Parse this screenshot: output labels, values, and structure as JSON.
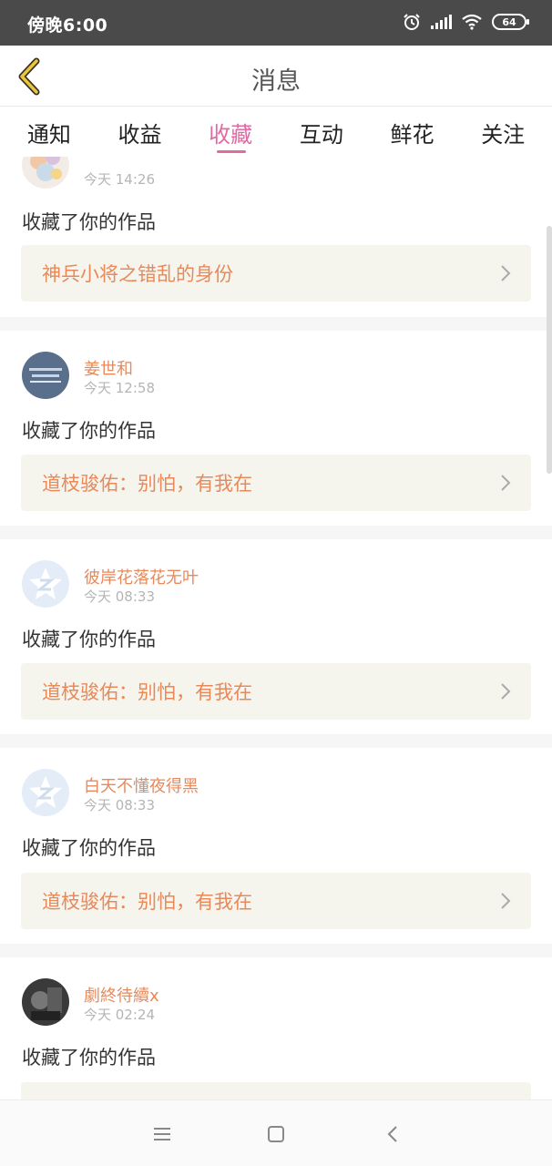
{
  "status_bar": {
    "time": "傍晚6:00",
    "battery": "64"
  },
  "header": {
    "title": "消息"
  },
  "tabs": [
    {
      "label": "通知",
      "active": false
    },
    {
      "label": "收益",
      "active": false
    },
    {
      "label": "收藏",
      "active": true
    },
    {
      "label": "互动",
      "active": false
    },
    {
      "label": "鲜花",
      "active": false
    },
    {
      "label": "关注",
      "active": false
    }
  ],
  "colors": {
    "accent": "#e06aa2",
    "name": "#e8895a",
    "work_bg": "#f5f5ee"
  },
  "messages": [
    {
      "username": "",
      "time": "今天 14:26",
      "action": "收藏了你的作品",
      "work": "神兵小将之错乱的身份"
    },
    {
      "username": "姜世和",
      "time": "今天 12:58",
      "action": "收藏了你的作品",
      "work": "道枝骏佑：别怕，有我在"
    },
    {
      "username": "彼岸花落花无叶",
      "time": "今天 08:33",
      "action": "收藏了你的作品",
      "work": "道枝骏佑：别怕，有我在"
    },
    {
      "username": "白天不懂夜得黑",
      "time": "今天 08:33",
      "action": "收藏了你的作品",
      "work": "道枝骏佑：别怕，有我在"
    },
    {
      "username": "劇終待續x",
      "time": "今天 02:24",
      "action": "收藏了你的作品",
      "work": ""
    }
  ]
}
